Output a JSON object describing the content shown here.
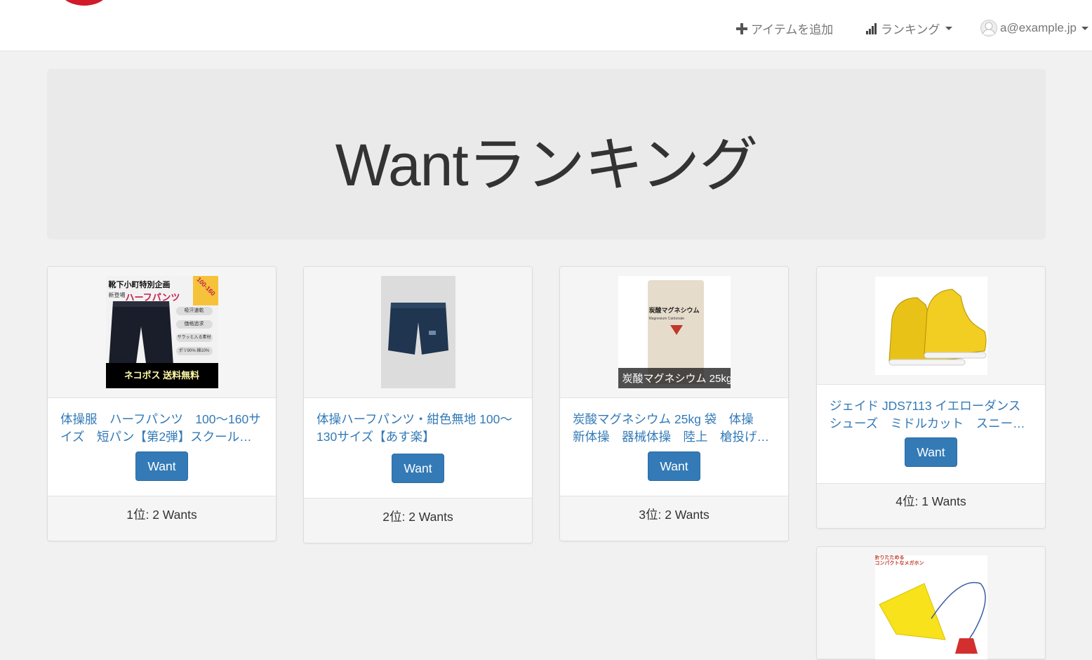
{
  "nav": {
    "add_item": "アイテムを追加",
    "ranking": "ランキング",
    "user_email": "a@example.jp"
  },
  "page_title": "Wantランキング",
  "want_label": "Want",
  "items": [
    {
      "title": "体操服　ハーフパンツ　100～160サイズ　短パン【第2弾】スクール…",
      "rank_text": "1位: 2 Wants",
      "image_text": {
        "header": "靴下小町特別企画",
        "sub": "新登場",
        "main": "ハーフパンツ",
        "corner": "100-160",
        "tag1": "吸汗速乾",
        "tag2": "価格追求",
        "tag3": "サラッと入る素材",
        "tag4": "ポリ90% 綿10%",
        "banner": "ネコポス 送料無料"
      }
    },
    {
      "title": "体操ハーフパンツ・紺色無地 100～130サイズ【あす楽】",
      "rank_text": "2位: 2 Wants"
    },
    {
      "title": "炭酸マグネシウム 25kg 袋　体操　新体操　器械体操　陸上　槍投げ…",
      "rank_text": "3位: 2 Wants",
      "image_text": {
        "bag_label": "炭酸マグネシウム",
        "bag_sub": "Magnesium Carbonate",
        "caption": "炭酸マグネシウム 25kg"
      }
    },
    {
      "title": "ジェイド JDS7113 イエローダンスシューズ　ミドルカット　スニー…",
      "rank_text": "4位: 1 Wants"
    },
    {
      "image_text": {
        "header": "折りたためる\nコンパクトなメガホン"
      }
    }
  ],
  "colors": {
    "link": "#337ab7",
    "button": "#337ab7",
    "background": "#f1f1f1",
    "brand": "#d11a2a"
  }
}
